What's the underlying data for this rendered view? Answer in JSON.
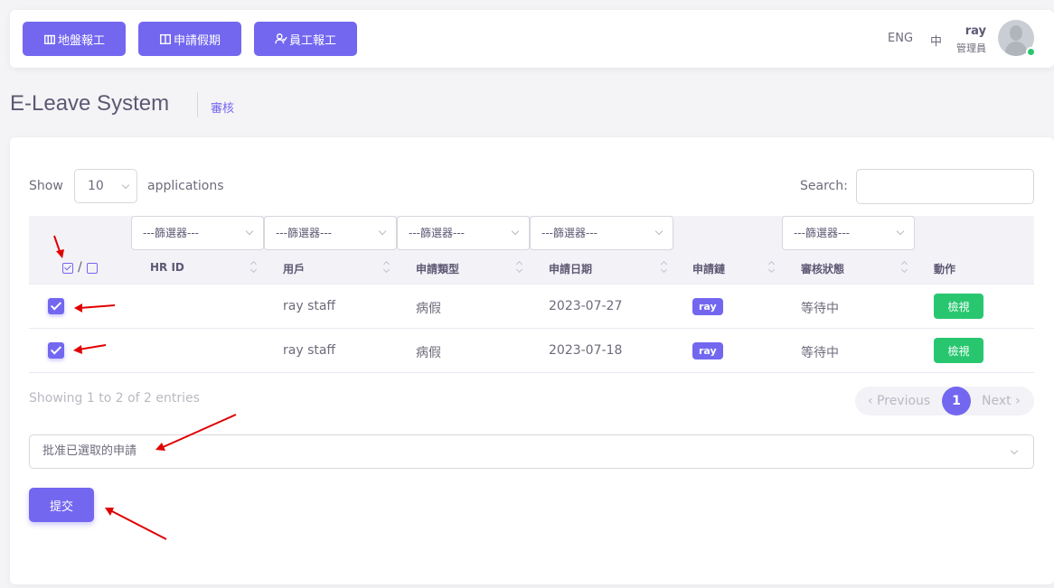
{
  "nav": {
    "buttons": [
      {
        "label": "地盤報工",
        "icon": "building-icon"
      },
      {
        "label": "申請假期",
        "icon": "calendar-icon"
      },
      {
        "label": "員工報工",
        "icon": "user-check-icon"
      }
    ],
    "lang_en": "ENG",
    "lang_zh": "中",
    "user_name": "ray",
    "user_role": "管理員",
    "online_color": "#28c76f"
  },
  "header": {
    "title": "E-Leave System",
    "breadcrumb": "審核"
  },
  "table_controls": {
    "show_label": "Show",
    "page_length": "10",
    "apps_label": "applications",
    "search_label": "Search:",
    "search_value": ""
  },
  "filters": [
    "---篩選器---",
    "---篩選器---",
    "---篩選器---",
    "---篩選器---",
    "---篩選器---"
  ],
  "columns": {
    "select": "/",
    "hr_id": "HR ID",
    "user": "用戶",
    "type": "申請類型",
    "date": "申請日期",
    "chain": "申請鏈",
    "status": "審核狀態",
    "action": "動作"
  },
  "rows": [
    {
      "checked": true,
      "hr_id": "",
      "user": "ray staff",
      "type": "病假",
      "date": "2023-07-27",
      "chain": "ray",
      "status": "等待中",
      "action": "檢視"
    },
    {
      "checked": true,
      "hr_id": "",
      "user": "ray staff",
      "type": "病假",
      "date": "2023-07-18",
      "chain": "ray",
      "status": "等待中",
      "action": "檢視"
    }
  ],
  "footer": {
    "info": "Showing 1 to 2 of 2 entries",
    "prev": "‹ Previous",
    "page": "1",
    "next": "Next ›"
  },
  "bulk": {
    "action_value": "批准已選取的申請",
    "submit_label": "提交"
  },
  "colors": {
    "primary": "#7367f0",
    "success": "#28c76f",
    "annotation": "#e00000"
  }
}
